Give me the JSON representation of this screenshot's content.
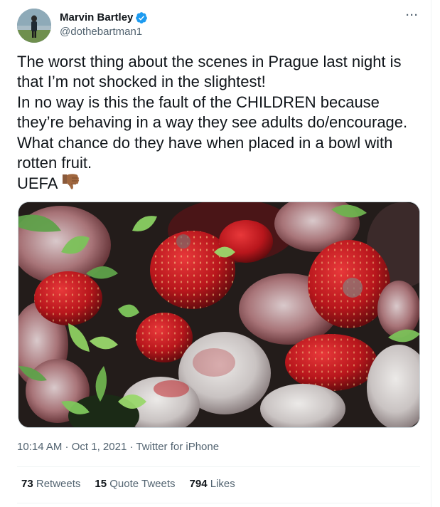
{
  "author": {
    "display_name": "Marvin Bartley",
    "handle": "@dothebartman1",
    "verified": true
  },
  "tweet": {
    "lines": [
      "The worst thing about the scenes in Prague last night is that I’m not shocked in the slightest!",
      "In no way is this the fault of the CHILDREN because they’re behaving in a way they see adults do/encourage. What chance do they have when placed in a bowl with rotten fruit.",
      "UEFA"
    ],
    "emoji": "thumbs-down-icon"
  },
  "media": {
    "description": "photo-of-moldy-strawberries"
  },
  "meta": {
    "time": "10:14 AM",
    "separator1": " · ",
    "date": "Oct 1, 2021",
    "separator2": " · ",
    "source": "Twitter for iPhone"
  },
  "stats": {
    "retweets_count": "73",
    "retweets_label": "Retweets",
    "quote_count": "15",
    "quote_label": "Quote Tweets",
    "likes_count": "794",
    "likes_label": "Likes"
  },
  "colors": {
    "text_primary": "#0f1419",
    "text_secondary": "#536471",
    "verified_blue": "#1d9bf0",
    "divider": "#eff3f4"
  }
}
